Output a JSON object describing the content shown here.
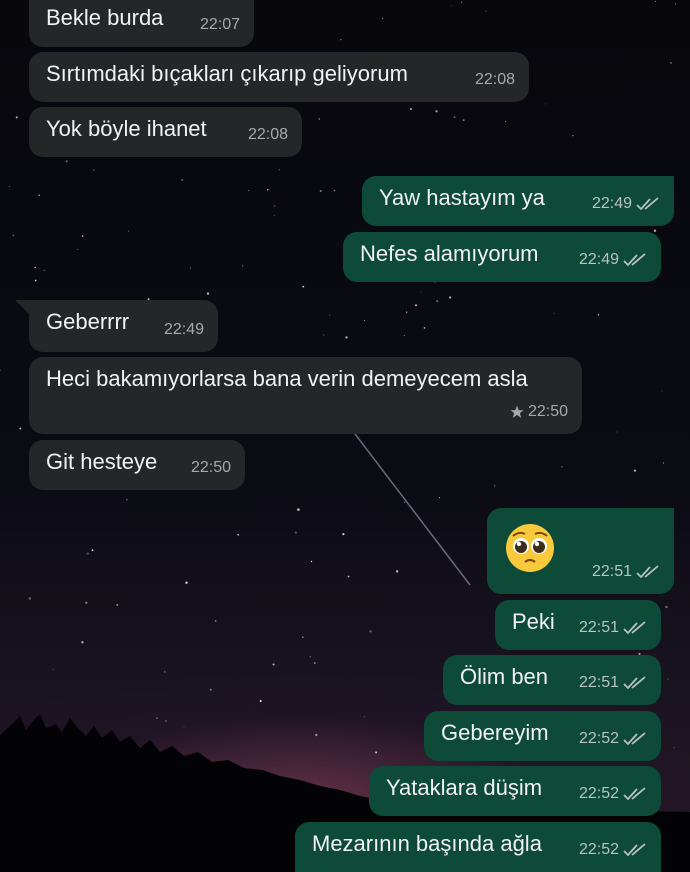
{
  "messages": [
    {
      "text": "Bekle burda",
      "time": "22:07",
      "dir": "in"
    },
    {
      "text": "Sırtımdaki bıçakları çıkarıp geliyorum",
      "time": "22:08",
      "dir": "in"
    },
    {
      "text": "Yok böyle ihanet",
      "time": "22:08",
      "dir": "in"
    },
    {
      "text": "Yaw hastayım ya",
      "time": "22:49",
      "dir": "out"
    },
    {
      "text": "Nefes alamıyorum",
      "time": "22:49",
      "dir": "out"
    },
    {
      "text": "Geberrrr",
      "time": "22:49",
      "dir": "in"
    },
    {
      "text": "Heci bakamıyorlarsa bana verin demeyecem asla",
      "time": "22:50",
      "dir": "in",
      "starred": true
    },
    {
      "text": "Git hesteye",
      "time": "22:50",
      "dir": "in"
    },
    {
      "text": "",
      "emoji": "pleading-face",
      "time": "22:51",
      "dir": "out"
    },
    {
      "text": "Peki",
      "time": "22:51",
      "dir": "out"
    },
    {
      "text": "Ölim ben",
      "time": "22:51",
      "dir": "out"
    },
    {
      "text": "Gebereyim",
      "time": "22:52",
      "dir": "out"
    },
    {
      "text": "Yataklara düşim",
      "time": "22:52",
      "dir": "out"
    },
    {
      "text": "Mezarının başında ağla",
      "time": "22:52",
      "dir": "out"
    }
  ],
  "icons": {
    "read_receipt": "double-check-icon",
    "star": "star-icon"
  },
  "colors": {
    "incoming_bubble": "#242628",
    "outgoing_bubble": "#0d4a37",
    "text": "#f2f2f2",
    "meta": "#b9c2be"
  }
}
